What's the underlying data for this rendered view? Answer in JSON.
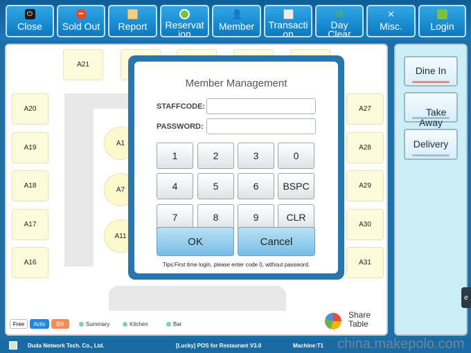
{
  "toolbar": {
    "buttons": [
      {
        "label": "Close",
        "icon": "power-icon",
        "color": "#1a1a1a"
      },
      {
        "label": "Sold Out",
        "icon": "no-entry-icon",
        "color": "#e04b2a"
      },
      {
        "label": "Report",
        "icon": "grid-icon",
        "color": "#f2a93b"
      },
      {
        "label": "Reservat\nion",
        "icon": "clock-icon",
        "color": "#7bc043"
      },
      {
        "label": "Member",
        "icon": "person-icon",
        "color": "#444"
      },
      {
        "label": "Transacti\non",
        "icon": "ledger-icon",
        "color": "#ddd"
      },
      {
        "label": "Day\nClear",
        "icon": "recycle-icon",
        "color": "#7bc043"
      },
      {
        "label": "Misc.",
        "icon": "tools-icon",
        "color": "#ddd"
      },
      {
        "label": "Login",
        "icon": "lock-icon",
        "color": "#7bc043"
      }
    ]
  },
  "floor": {
    "tables": [
      "A21",
      "A20",
      "A19",
      "A18",
      "A17",
      "A16",
      "A1",
      "A7",
      "A11",
      "A27",
      "A28",
      "A29",
      "A30",
      "A31"
    ],
    "legend": {
      "free": "Free",
      "active": "Activ",
      "bill": "Bill",
      "summary": "Summary",
      "kitchen": "Kitchen",
      "bar": "Bar"
    },
    "share_table": "Share\nTable"
  },
  "right_panel": {
    "dine_in": "Dine In",
    "take_away": "Take\nAway",
    "delivery": "Delivery"
  },
  "modal": {
    "title": "Member Management",
    "staffcode_label": "STAFFCODE:",
    "password_label": "PASSWORD:",
    "staffcode_value": "",
    "password_value": "",
    "keys": [
      "1",
      "2",
      "3",
      "0",
      "4",
      "5",
      "6",
      "BSPC",
      "7",
      "8",
      "9",
      "CLR"
    ],
    "ok": "OK",
    "cancel": "Cancel",
    "tips": "Tips:First time login, please enter code 0, without password."
  },
  "status": {
    "company": "Duda Network Tech. Co., Ltd.",
    "product": "[Lucky] POS for Restaurant V3.0",
    "machine": "Machine:T1"
  },
  "watermark": "china.makepolo.com",
  "colors": {
    "active": "#1e88e5",
    "bill": "#f28c5a",
    "free": "#ffffff",
    "accent": "#2a76ab"
  }
}
